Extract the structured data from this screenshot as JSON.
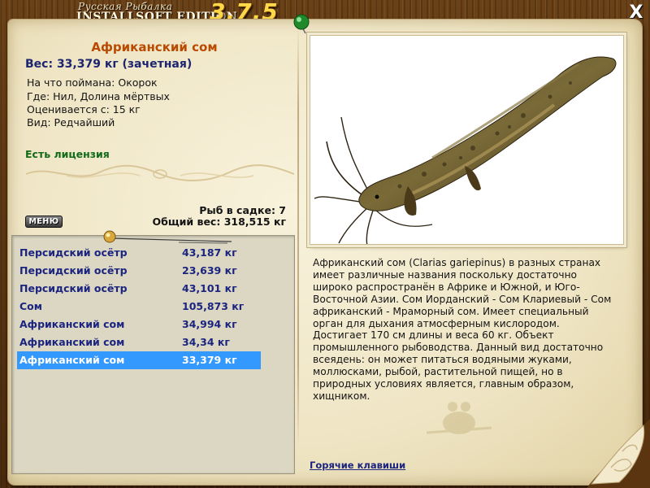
{
  "titlebar": {
    "small": "Русская Рыбалка",
    "big": "INSTALLSOFT EDITION",
    "version": "3.7.5",
    "close_label": "X"
  },
  "fish": {
    "name": "Африканский сом",
    "weight": "Вес: 33,379 кг (зачетная)",
    "bait": "На что поймана: Окорок",
    "place": "Где: Нил, Долина мёртвых",
    "valued_from": "Оценивается с: 15 кг",
    "kind": "Вид: Редчайший",
    "license": "Есть лицензия",
    "description": "Африканский сом (Clarias gariepinus) в разных странах имеет различные названия поскольку достаточно широко распространён в Африке и Южной, и Юго-Восточной Азии. Сом Иорданский - Сом Клариевый - Сом африканский - Мраморный сом. Имеет специальный орган для дыхания атмосферным кислородом. Достигает 170 см длины и веса 60 кг. Объект промышленного рыбоводства. Данный вид достаточно всеядень: он может питаться водяными жуками, моллюсками, рыбой, растительной пищей, но в природных условиях является, главным образом, хищником."
  },
  "cage": {
    "count": "Рыб в садке: 7",
    "total": "Общий вес: 318,515 кг"
  },
  "menu_label": "МЕНЮ",
  "catch": [
    {
      "name": "Персидский осётр",
      "weight": "43,187 кг"
    },
    {
      "name": "Персидский осётр",
      "weight": "23,639 кг"
    },
    {
      "name": "Персидский осётр",
      "weight": "43,101 кг"
    },
    {
      "name": "Сом",
      "weight": "105,873 кг"
    },
    {
      "name": "Африканский сом",
      "weight": "34,994 кг"
    },
    {
      "name": "Африканский сом",
      "weight": "34,34 кг"
    },
    {
      "name": "Африканский сом",
      "weight": "33,379 кг"
    }
  ],
  "selected_index": 6,
  "hotkeys_label": "Горячие клавиши",
  "colors": {
    "fish_name": "#b94a00",
    "weight_text": "#1b2570",
    "license": "#136a18",
    "list_text": "#1b2580",
    "selection": "#3399ff",
    "version": "#ffd84a"
  },
  "icons": {
    "close": "close-icon",
    "green_pin": "green-pin-icon",
    "gold_pin": "gold-pin-icon",
    "fish_photo": "catfish-image",
    "watermark": "fishing-logo-watermark",
    "page_curl": "page-curl-ornament"
  }
}
